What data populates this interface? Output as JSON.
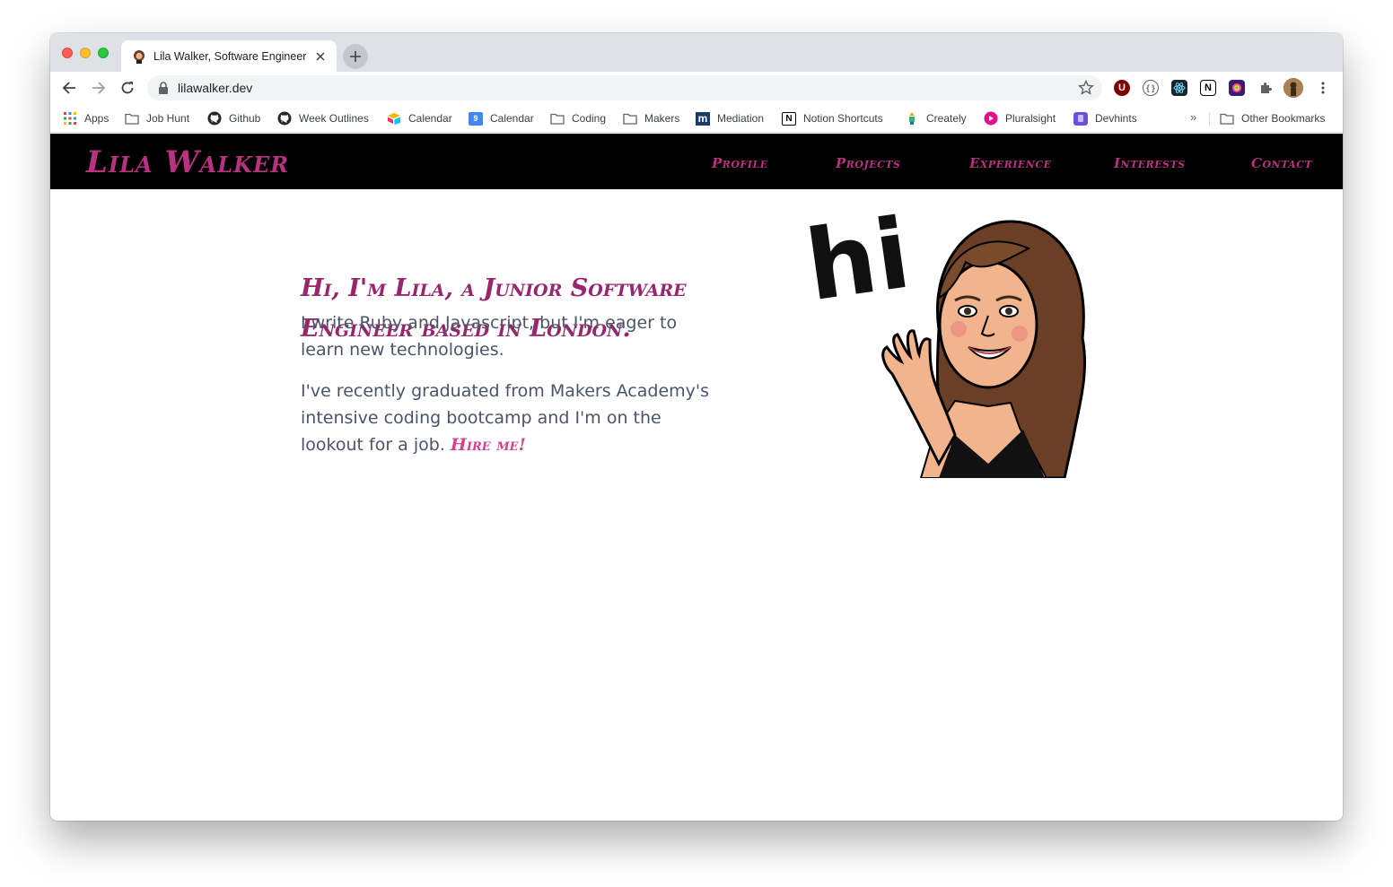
{
  "browser": {
    "tab_title": "Lila Walker, Software Engineer",
    "url": "lilawalker.dev",
    "bookmarks": [
      {
        "label": "Apps",
        "icon": "apps-grid-icon"
      },
      {
        "label": "Job Hunt",
        "icon": "folder-icon"
      },
      {
        "label": "Github",
        "icon": "github-icon"
      },
      {
        "label": "Week Outlines",
        "icon": "github-icon"
      },
      {
        "label": "Calendar",
        "icon": "airtable-icon"
      },
      {
        "label": "Calendar",
        "icon": "google-calendar-icon"
      },
      {
        "label": "Coding",
        "icon": "folder-icon"
      },
      {
        "label": "Makers",
        "icon": "folder-icon"
      },
      {
        "label": "Mediation",
        "icon": "medium-icon"
      },
      {
        "label": "Notion Shortcuts",
        "icon": "notion-icon"
      },
      {
        "label": "Creately",
        "icon": "creately-icon"
      },
      {
        "label": "Pluralsight",
        "icon": "pluralsight-icon"
      },
      {
        "label": "Devhints",
        "icon": "devhints-icon"
      }
    ],
    "overflow_label": "»",
    "other_bookmarks": "Other Bookmarks",
    "calendar_day": "9"
  },
  "site": {
    "brand": "Lila Walker",
    "nav": [
      "Profile",
      "Projects",
      "Experience",
      "Interests",
      "Contact"
    ],
    "heading": "Hi, I'm Lila, a Junior Software Engineer based in London.",
    "para1": "I write Ruby and Javascript, but I'm eager to learn new technologies.",
    "para2": "I've recently graduated from Makers Academy's intensive coding bootcamp and I'm on the lookout for a job.",
    "hire_link": "Hire me!",
    "avatar_text": "hi",
    "accent_color": "#b83280"
  }
}
